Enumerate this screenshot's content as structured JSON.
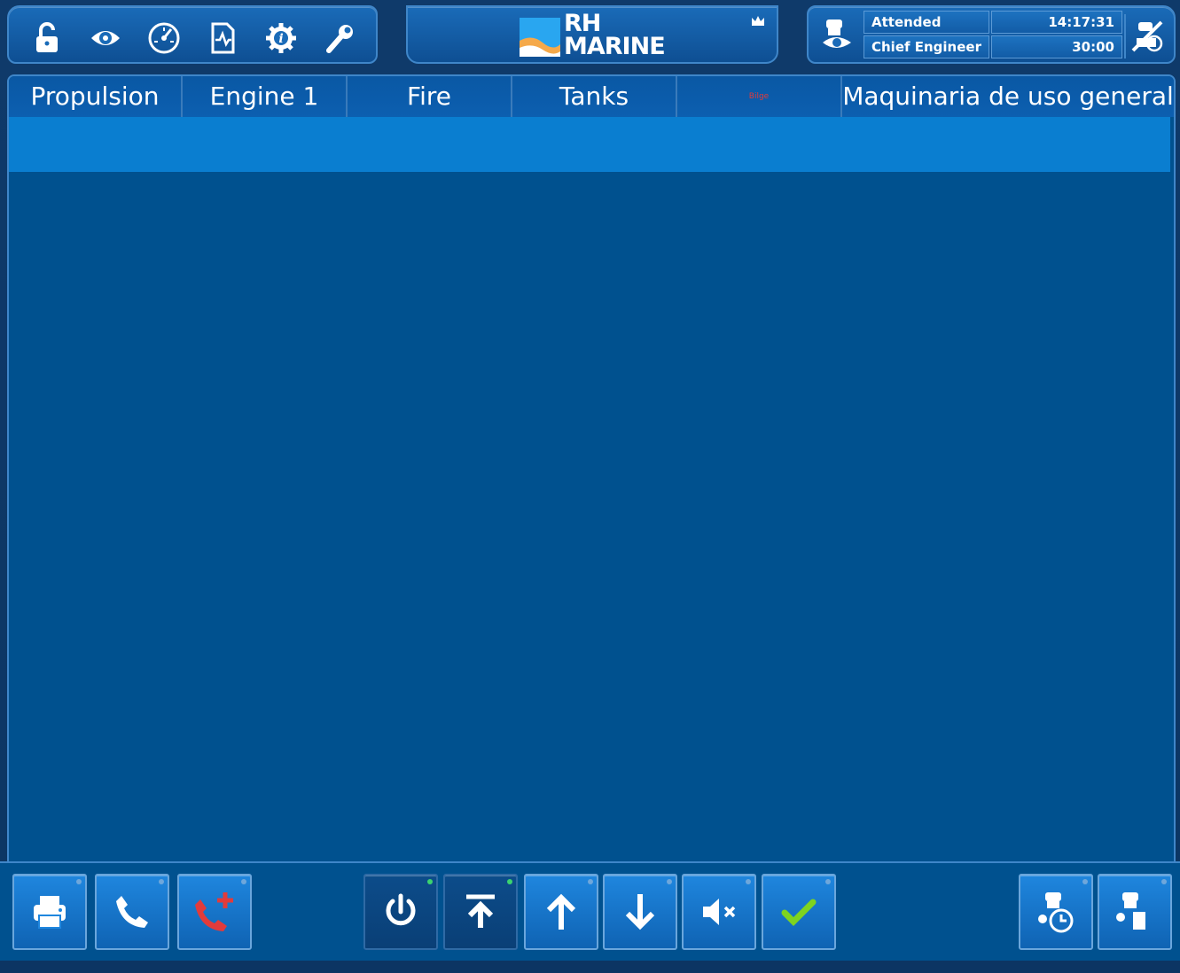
{
  "header": {
    "left_icons": [
      {
        "name": "unlock-icon"
      },
      {
        "name": "alarm-settings-icon"
      },
      {
        "name": "gauge-icon"
      },
      {
        "name": "trend-document-icon"
      },
      {
        "name": "info-gear-icon"
      },
      {
        "name": "wrench-icon"
      }
    ],
    "logo": {
      "line1": "RH",
      "line2": "MARINE"
    },
    "status": {
      "mode": "Attended",
      "role": "Chief Engineer",
      "clock": "14:17:31",
      "timer": "30:00"
    }
  },
  "tabs": [
    {
      "label": "Propulsion",
      "width": 196
    },
    {
      "label": "Engine 1",
      "width": 186
    },
    {
      "label": "Fire",
      "width": 186
    },
    {
      "label": "Tanks",
      "width": 186
    },
    {
      "label": "Bilge",
      "width": 186
    },
    {
      "label": "Maquinaria de uso general",
      "width": 374
    }
  ],
  "toolbar": {
    "left": [
      {
        "name": "print-button"
      },
      {
        "name": "call-button"
      },
      {
        "name": "emergency-call-button"
      }
    ],
    "center": [
      {
        "name": "power-button",
        "led": "on"
      },
      {
        "name": "scroll-top-button",
        "led": "on"
      },
      {
        "name": "scroll-up-button"
      },
      {
        "name": "scroll-down-button"
      },
      {
        "name": "mute-button"
      },
      {
        "name": "acknowledge-button"
      }
    ],
    "right": [
      {
        "name": "watch-schedule-button"
      },
      {
        "name": "engineer-call-button"
      }
    ]
  },
  "colors": {
    "background": "#00518f",
    "accent": "#0a7ed0",
    "border": "#3f86c9",
    "ack_green": "#7ed321",
    "alert_red": "#e23b3b"
  }
}
